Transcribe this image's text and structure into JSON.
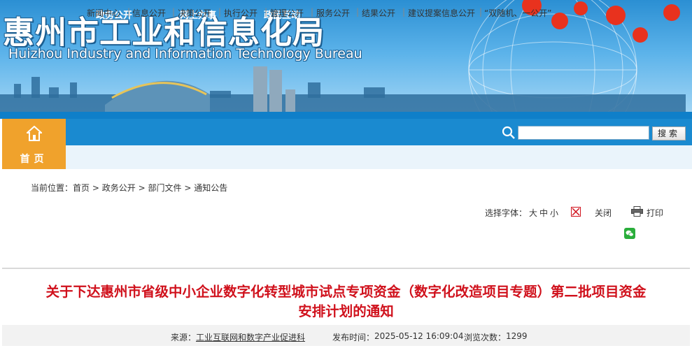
{
  "header": {
    "title_zh": "惠州市工业和信息化局",
    "title_en": "Huizhou Industry and Information Technology Bureau"
  },
  "nav": {
    "home_label": "首页",
    "items": [
      "政务公开",
      "网上办事",
      "政民互动"
    ],
    "search_placeholder": "",
    "search_button": "搜索"
  },
  "subnav": {
    "items": [
      "新闻中心",
      "信息公开",
      "决策公开",
      "执行公开",
      "管理公开",
      "服务公开",
      "结果公开",
      "建议提案信息公开",
      "“双随机、一公开”"
    ]
  },
  "breadcrumb": {
    "prefix": "当前位置：",
    "items": [
      "首页",
      "政务公开",
      "部门文件",
      "通知公告"
    ],
    "separator": ">"
  },
  "toolbar": {
    "font_label": "选择字体：",
    "font_large": "大",
    "font_medium": "中",
    "font_small": "小",
    "close_label": "关闭",
    "print_label": "打印"
  },
  "article": {
    "title_line1": "关于下达惠州市省级中小企业数字化转型城市试点专项资金（数字化改造项目专题）第二批项目资金",
    "title_line2": "安排计划的通知",
    "source_label": "来源：",
    "source": "工业互联网和数字产业促进科",
    "time_label": "发布时间：",
    "time": "2025-05-12 16:09:04",
    "views_label": "浏览次数：",
    "views": "1299"
  },
  "colors": {
    "nav_blue": "#1a8ad0",
    "home_orange": "#f0a22c",
    "title_red": "#d0111c"
  }
}
